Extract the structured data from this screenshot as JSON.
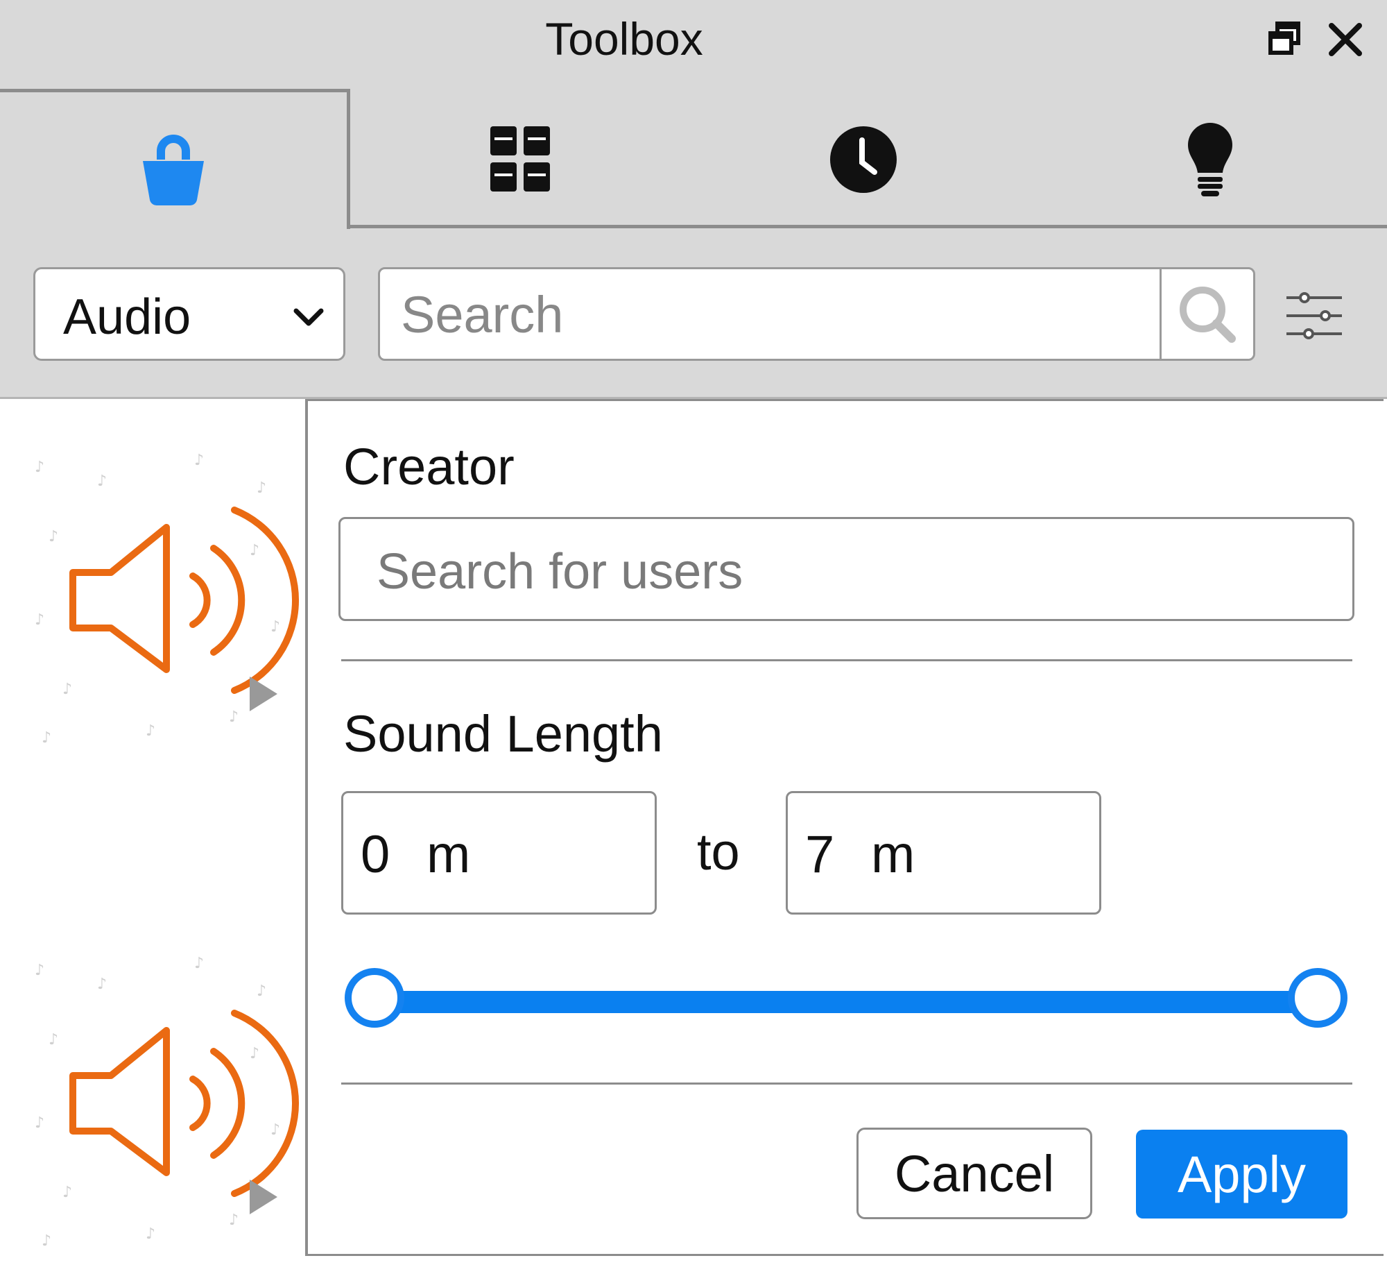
{
  "window": {
    "title": "Toolbox",
    "restore_icon": "restore-window-icon",
    "close_icon": "close-icon"
  },
  "tabs": [
    {
      "icon": "shopping-bag-icon",
      "active": true,
      "color": "#1e88f0"
    },
    {
      "icon": "grid-icon",
      "active": false
    },
    {
      "icon": "clock-icon",
      "active": false
    },
    {
      "icon": "lightbulb-icon",
      "active": false
    }
  ],
  "toolbar": {
    "category_value": "Audio",
    "search_placeholder": "Search",
    "search_icon": "search-icon",
    "filter_icon": "sliders-icon"
  },
  "results": [
    {
      "type": "audio",
      "icon": "speaker-icon",
      "color": "#ea6a12"
    },
    {
      "type": "audio",
      "icon": "speaker-icon",
      "color": "#ea6a12"
    }
  ],
  "filters": {
    "creator_label": "Creator",
    "creator_placeholder": "Search for users",
    "length_label": "Sound Length",
    "min_value": "0",
    "min_unit": "m",
    "to_label": "to",
    "max_value": "7",
    "max_unit": "m",
    "slider_min_fraction": 0,
    "slider_max_fraction": 1,
    "cancel_label": "Cancel",
    "apply_label": "Apply",
    "accent_color": "#0a80f0"
  }
}
